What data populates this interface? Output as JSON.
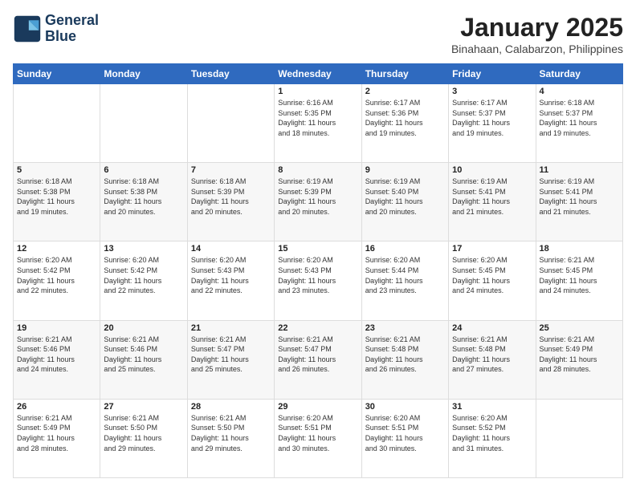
{
  "header": {
    "logo_line1": "General",
    "logo_line2": "Blue",
    "month_title": "January 2025",
    "location": "Binahaan, Calabarzon, Philippines"
  },
  "days_of_week": [
    "Sunday",
    "Monday",
    "Tuesday",
    "Wednesday",
    "Thursday",
    "Friday",
    "Saturday"
  ],
  "weeks": [
    [
      {
        "day": "",
        "info": ""
      },
      {
        "day": "",
        "info": ""
      },
      {
        "day": "",
        "info": ""
      },
      {
        "day": "1",
        "info": "Sunrise: 6:16 AM\nSunset: 5:35 PM\nDaylight: 11 hours\nand 18 minutes."
      },
      {
        "day": "2",
        "info": "Sunrise: 6:17 AM\nSunset: 5:36 PM\nDaylight: 11 hours\nand 19 minutes."
      },
      {
        "day": "3",
        "info": "Sunrise: 6:17 AM\nSunset: 5:37 PM\nDaylight: 11 hours\nand 19 minutes."
      },
      {
        "day": "4",
        "info": "Sunrise: 6:18 AM\nSunset: 5:37 PM\nDaylight: 11 hours\nand 19 minutes."
      }
    ],
    [
      {
        "day": "5",
        "info": "Sunrise: 6:18 AM\nSunset: 5:38 PM\nDaylight: 11 hours\nand 19 minutes."
      },
      {
        "day": "6",
        "info": "Sunrise: 6:18 AM\nSunset: 5:38 PM\nDaylight: 11 hours\nand 20 minutes."
      },
      {
        "day": "7",
        "info": "Sunrise: 6:18 AM\nSunset: 5:39 PM\nDaylight: 11 hours\nand 20 minutes."
      },
      {
        "day": "8",
        "info": "Sunrise: 6:19 AM\nSunset: 5:39 PM\nDaylight: 11 hours\nand 20 minutes."
      },
      {
        "day": "9",
        "info": "Sunrise: 6:19 AM\nSunset: 5:40 PM\nDaylight: 11 hours\nand 20 minutes."
      },
      {
        "day": "10",
        "info": "Sunrise: 6:19 AM\nSunset: 5:41 PM\nDaylight: 11 hours\nand 21 minutes."
      },
      {
        "day": "11",
        "info": "Sunrise: 6:19 AM\nSunset: 5:41 PM\nDaylight: 11 hours\nand 21 minutes."
      }
    ],
    [
      {
        "day": "12",
        "info": "Sunrise: 6:20 AM\nSunset: 5:42 PM\nDaylight: 11 hours\nand 22 minutes."
      },
      {
        "day": "13",
        "info": "Sunrise: 6:20 AM\nSunset: 5:42 PM\nDaylight: 11 hours\nand 22 minutes."
      },
      {
        "day": "14",
        "info": "Sunrise: 6:20 AM\nSunset: 5:43 PM\nDaylight: 11 hours\nand 22 minutes."
      },
      {
        "day": "15",
        "info": "Sunrise: 6:20 AM\nSunset: 5:43 PM\nDaylight: 11 hours\nand 23 minutes."
      },
      {
        "day": "16",
        "info": "Sunrise: 6:20 AM\nSunset: 5:44 PM\nDaylight: 11 hours\nand 23 minutes."
      },
      {
        "day": "17",
        "info": "Sunrise: 6:20 AM\nSunset: 5:45 PM\nDaylight: 11 hours\nand 24 minutes."
      },
      {
        "day": "18",
        "info": "Sunrise: 6:21 AM\nSunset: 5:45 PM\nDaylight: 11 hours\nand 24 minutes."
      }
    ],
    [
      {
        "day": "19",
        "info": "Sunrise: 6:21 AM\nSunset: 5:46 PM\nDaylight: 11 hours\nand 24 minutes."
      },
      {
        "day": "20",
        "info": "Sunrise: 6:21 AM\nSunset: 5:46 PM\nDaylight: 11 hours\nand 25 minutes."
      },
      {
        "day": "21",
        "info": "Sunrise: 6:21 AM\nSunset: 5:47 PM\nDaylight: 11 hours\nand 25 minutes."
      },
      {
        "day": "22",
        "info": "Sunrise: 6:21 AM\nSunset: 5:47 PM\nDaylight: 11 hours\nand 26 minutes."
      },
      {
        "day": "23",
        "info": "Sunrise: 6:21 AM\nSunset: 5:48 PM\nDaylight: 11 hours\nand 26 minutes."
      },
      {
        "day": "24",
        "info": "Sunrise: 6:21 AM\nSunset: 5:48 PM\nDaylight: 11 hours\nand 27 minutes."
      },
      {
        "day": "25",
        "info": "Sunrise: 6:21 AM\nSunset: 5:49 PM\nDaylight: 11 hours\nand 28 minutes."
      }
    ],
    [
      {
        "day": "26",
        "info": "Sunrise: 6:21 AM\nSunset: 5:49 PM\nDaylight: 11 hours\nand 28 minutes."
      },
      {
        "day": "27",
        "info": "Sunrise: 6:21 AM\nSunset: 5:50 PM\nDaylight: 11 hours\nand 29 minutes."
      },
      {
        "day": "28",
        "info": "Sunrise: 6:21 AM\nSunset: 5:50 PM\nDaylight: 11 hours\nand 29 minutes."
      },
      {
        "day": "29",
        "info": "Sunrise: 6:20 AM\nSunset: 5:51 PM\nDaylight: 11 hours\nand 30 minutes."
      },
      {
        "day": "30",
        "info": "Sunrise: 6:20 AM\nSunset: 5:51 PM\nDaylight: 11 hours\nand 30 minutes."
      },
      {
        "day": "31",
        "info": "Sunrise: 6:20 AM\nSunset: 5:52 PM\nDaylight: 11 hours\nand 31 minutes."
      },
      {
        "day": "",
        "info": ""
      }
    ]
  ]
}
